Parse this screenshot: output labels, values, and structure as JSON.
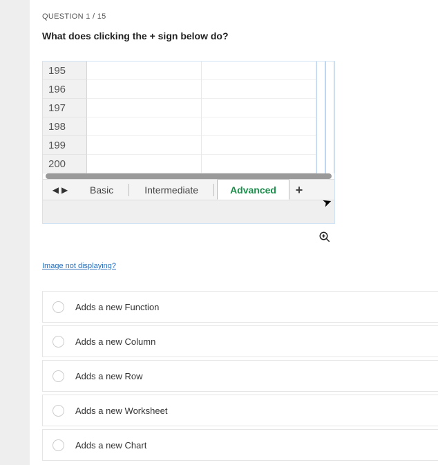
{
  "question": {
    "counter": "QUESTION 1 / 15",
    "text": "What does clicking the + sign below do?"
  },
  "screenshot": {
    "rowNumbers": [
      "195",
      "196",
      "197",
      "198",
      "199",
      "200"
    ],
    "tabs": {
      "basic": "Basic",
      "intermediate": "Intermediate",
      "advanced": "Advanced"
    },
    "plus": "+"
  },
  "link": {
    "notDisplaying": "Image not displaying?"
  },
  "answers": [
    {
      "label": "Adds a new Function"
    },
    {
      "label": "Adds a new Column"
    },
    {
      "label": "Adds a new Row"
    },
    {
      "label": "Adds a new Worksheet"
    },
    {
      "label": "Adds a new Chart"
    }
  ]
}
